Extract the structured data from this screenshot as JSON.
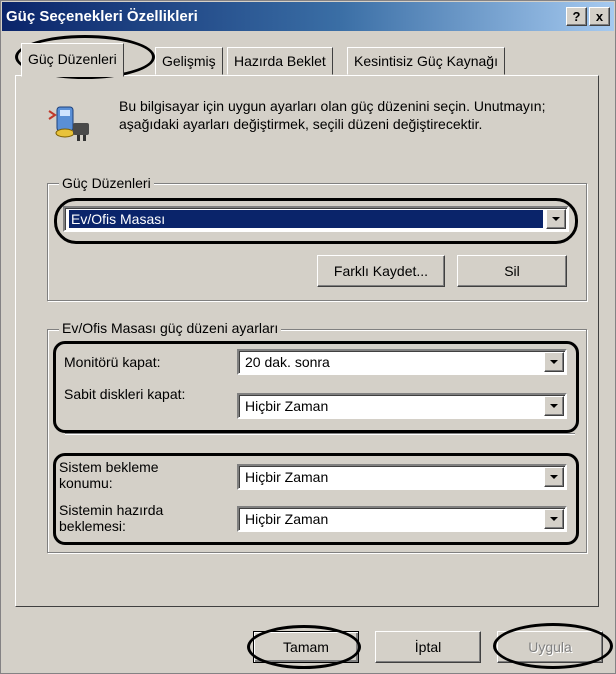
{
  "window": {
    "title": "Güç Seçenekleri Özellikleri",
    "help_label": "?",
    "close_label": "x"
  },
  "tabs": [
    {
      "label": "Güç Düzenleri",
      "active": true
    },
    {
      "label": "Gelişmiş",
      "active": false
    },
    {
      "label": "Hazırda Beklet",
      "active": false
    },
    {
      "label": "Kesintisiz Güç Kaynağı",
      "active": false
    }
  ],
  "intro": {
    "icon": "power-scheme-icon",
    "text": "Bu bilgisayar için uygun ayarları olan güç düzenini seçin. Unutmayın; aşağıdaki ayarları değiştirmek, seçili düzeni değiştirecektir."
  },
  "schemes": {
    "group_label": "Güç Düzenleri",
    "selected": "Ev/Ofis Masası",
    "save_as_label": "Farklı Kaydet...",
    "delete_label": "Sil"
  },
  "settings": {
    "group_label": "Ev/Ofis Masası güç düzeni ayarları",
    "monitor_label": "Monitörü kapat:",
    "monitor_value": "20 dak. sonra",
    "disks_label": "Sabit diskleri kapat:",
    "disks_value": "Hiçbir Zaman",
    "standby_label_1": "Sistem bekleme",
    "standby_label_2": "konumu:",
    "standby_value": "Hiçbir Zaman",
    "hibernate_label_1": "Sistemin hazırda",
    "hibernate_label_2": "beklemesi:",
    "hibernate_value": "Hiçbir Zaman"
  },
  "footer": {
    "ok_label": "Tamam",
    "cancel_label": "İptal",
    "apply_label": "Uygula"
  },
  "colors": {
    "titlebar_start": "#0a246a",
    "titlebar_end": "#a6caf0",
    "face": "#d4d0c8",
    "selection": "#0a246a"
  }
}
